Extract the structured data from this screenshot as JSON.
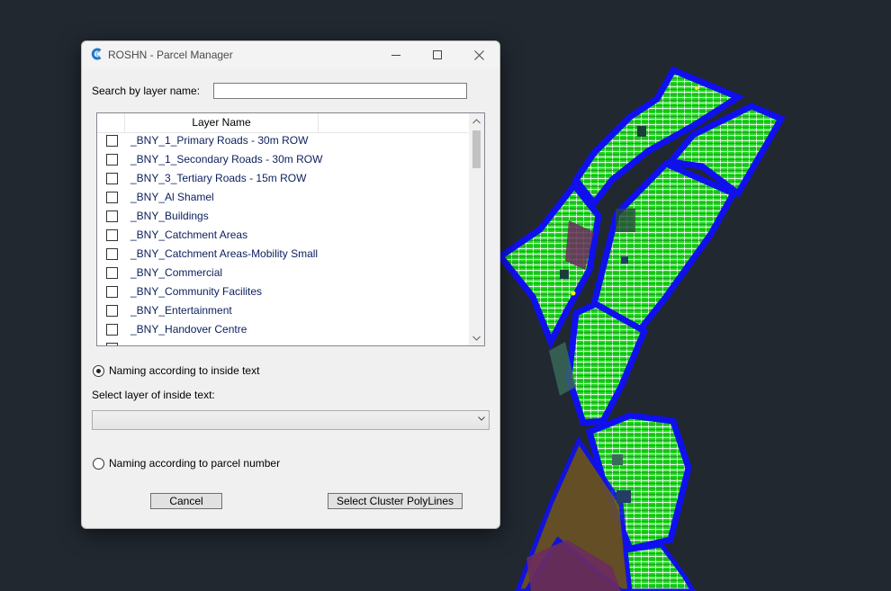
{
  "dialog": {
    "title": "ROSHN - Parcel Manager",
    "app_icon": "civil3d-c-icon",
    "window_controls": [
      "minimize-icon",
      "maximize-icon",
      "close-icon"
    ]
  },
  "search": {
    "label": "Search by layer name:",
    "value": "",
    "placeholder": ""
  },
  "layer_list": {
    "column_header": "Layer Name",
    "items": [
      {
        "label": "_BNY_1_Primary Roads - 30m ROW",
        "checked": false
      },
      {
        "label": "_BNY_1_Secondary Roads - 30m ROW",
        "checked": false
      },
      {
        "label": "_BNY_3_Tertiary Roads - 15m ROW",
        "checked": false
      },
      {
        "label": "_BNY_Al Shamel",
        "checked": false
      },
      {
        "label": "_BNY_Buildings",
        "checked": false
      },
      {
        "label": "_BNY_Catchment Areas",
        "checked": false
      },
      {
        "label": "_BNY_Catchment Areas-Mobility Small",
        "checked": false
      },
      {
        "label": "_BNY_Commercial",
        "checked": false
      },
      {
        "label": "_BNY_Community Facilites",
        "checked": false
      },
      {
        "label": "_BNY_Entertainment",
        "checked": false
      },
      {
        "label": "_BNY_Handover Centre",
        "checked": false
      }
    ]
  },
  "naming": {
    "inside_text_label": "Naming according to inside text",
    "inside_text_selected": true,
    "select_layer_label": "Select layer of inside text:",
    "select_layer_value": "",
    "parcel_number_label": "Naming according to parcel number",
    "parcel_number_selected": false
  },
  "buttons": {
    "cancel": "Cancel",
    "select_cluster": "Select Cluster PolyLines"
  },
  "colors": {
    "cad_background": "#212830",
    "parcel_fill": "#1bd41b",
    "road_boundary": "#1010ee",
    "open_space": "#6b2c5e",
    "commercial_fill": "#6b5326"
  }
}
